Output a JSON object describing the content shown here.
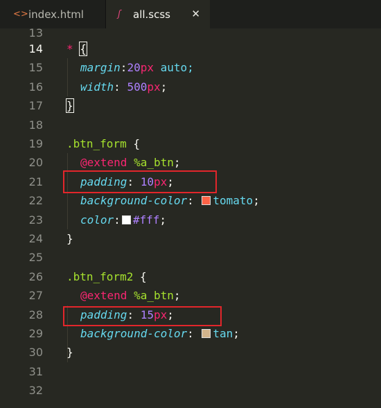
{
  "tabs": [
    {
      "icon": "<>",
      "label": "index.html"
    },
    {
      "icon": "ʃ",
      "label": "all.scss",
      "close": "✕"
    }
  ],
  "line_numbers": [
    "13",
    "14",
    "15",
    "16",
    "17",
    "18",
    "19",
    "20",
    "21",
    "22",
    "23",
    "24",
    "25",
    "26",
    "27",
    "28",
    "29",
    "30",
    "31",
    "32"
  ],
  "active_line": "14",
  "code": {
    "l14_star": "*",
    "l14_brace": "{",
    "l15_prop": "margin",
    "l15_colon": ":",
    "l15_num": "20",
    "l15_unit": "px",
    "l15_rest": " auto;",
    "l16_prop": "width",
    "l16_colon": ": ",
    "l16_num": "500",
    "l16_unit": "px",
    "l16_semi": ";",
    "l17_brace": "}",
    "l19_sel": ".btn_form",
    "l19_brace": " {",
    "l20_at": "@extend",
    "l20_ph": " %a_btn",
    "l20_semi": ";",
    "l21_prop": "padding",
    "l21_colon": ": ",
    "l21_num": "10",
    "l21_unit": "px",
    "l21_semi": ";",
    "l22_prop": "background-color",
    "l22_colon": ": ",
    "l22_val": "tomato",
    "l22_semi": ";",
    "l23_prop": "color",
    "l23_colon": ":",
    "l23_val": "#fff",
    "l23_semi": ";",
    "l24_brace": "}",
    "l26_sel": ".btn_form2",
    "l26_brace": " {",
    "l27_at": "@extend",
    "l27_ph": " %a_btn",
    "l27_semi": ";",
    "l28_prop": "padding",
    "l28_colon": ": ",
    "l28_num": "15",
    "l28_unit": "px",
    "l28_semi": ";",
    "l29_prop": "background-color",
    "l29_colon": ": ",
    "l29_val": "tan",
    "l29_semi": ";",
    "l30_brace": "}"
  },
  "colors": {
    "tomato_swatch": "#ff6347",
    "white_swatch": "#ffffff",
    "tan_swatch": "#d2b48c",
    "highlight_box": "#e3262b"
  }
}
